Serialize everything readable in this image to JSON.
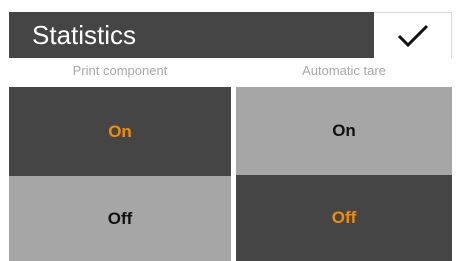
{
  "header": {
    "title": "Statistics",
    "confirm_icon": "checkmark-icon"
  },
  "columns": [
    {
      "label": "Print component",
      "options": [
        {
          "label": "On",
          "selected": true
        },
        {
          "label": "Off",
          "selected": false
        }
      ]
    },
    {
      "label": "Automatic tare",
      "options": [
        {
          "label": "On",
          "selected": false
        },
        {
          "label": "Off",
          "selected": true
        }
      ]
    }
  ],
  "colors": {
    "header_bg": "#454545",
    "selected_bg": "#454545",
    "selected_text": "#f28c00",
    "unselected_bg": "#a6a6a6",
    "unselected_text": "#111111",
    "column_label": "#a8a8a8"
  }
}
